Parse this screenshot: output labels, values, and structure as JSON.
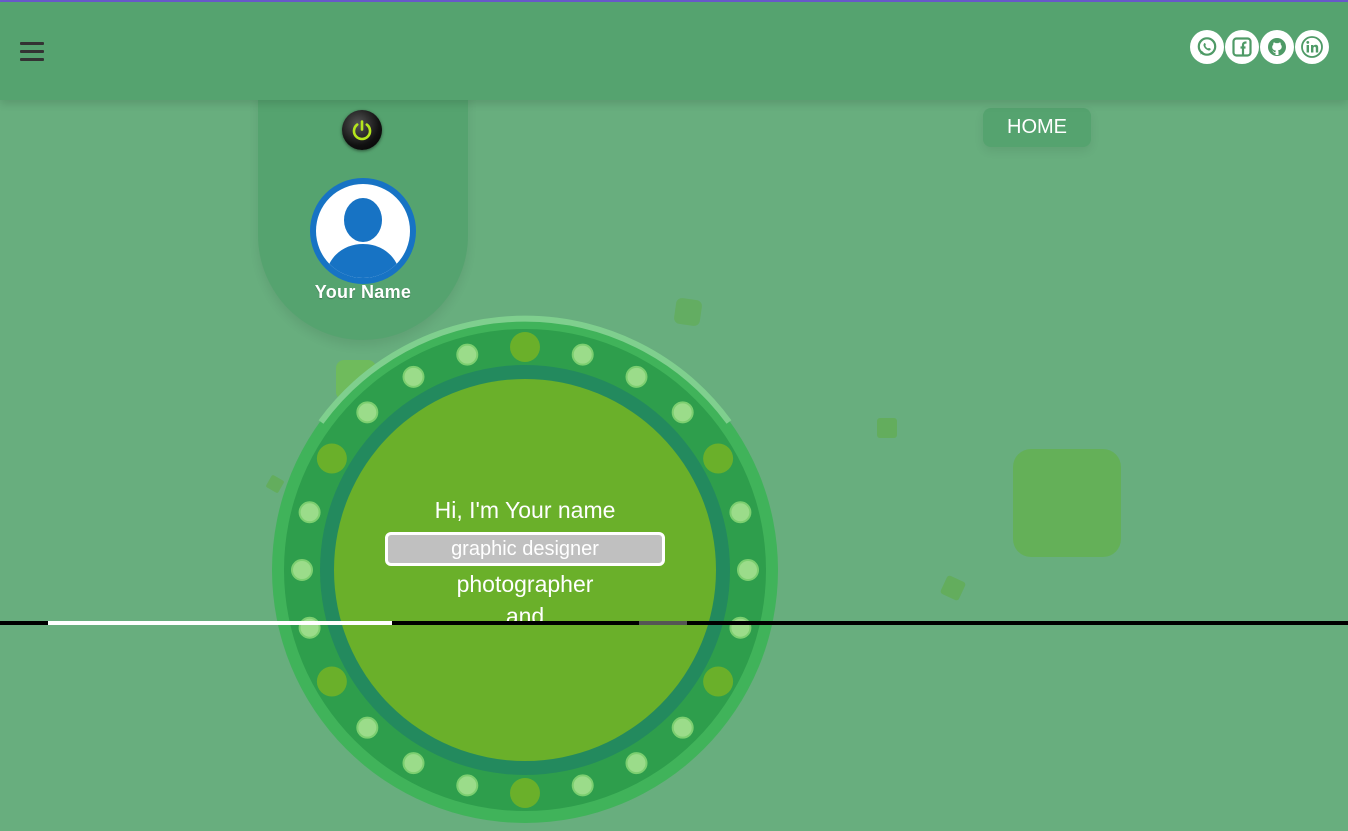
{
  "navbar": {
    "menu_icon": "hamburger-icon",
    "socials": [
      {
        "name": "whatsapp-icon"
      },
      {
        "name": "facebook-icon"
      },
      {
        "name": "github-icon"
      },
      {
        "name": "linkedin-icon"
      }
    ]
  },
  "profile": {
    "power_icon": "power-icon",
    "avatar_icon": "user-avatar-icon",
    "name": "Your Name"
  },
  "nav": {
    "home_label": "HOME"
  },
  "hero": {
    "greeting": "Hi, I'm Your name",
    "roles": [
      "graphic designer",
      "photographer",
      "and"
    ]
  },
  "colors": {
    "background": "#68ae7e",
    "navbar": "#55a36f",
    "avatar_blue": "#1773c4",
    "wheel_inner": "#6ab02a",
    "wheel_ring": "#2e9e4c",
    "power_accent": "#b5e61d"
  }
}
